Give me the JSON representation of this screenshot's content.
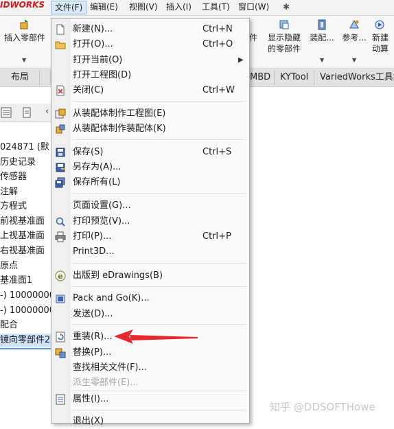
{
  "app": {
    "logo_text": "IDWORKS"
  },
  "menubar": {
    "items": [
      {
        "label": "文件(F)"
      },
      {
        "label": "编辑(E)"
      },
      {
        "label": "视图(V)"
      },
      {
        "label": "插入(I)"
      },
      {
        "label": "工具(T)"
      },
      {
        "label": "窗口(W)"
      }
    ]
  },
  "ribbon": {
    "insert_part": "插入零部件",
    "show_hidden_line1": "显示隐藏",
    "show_hidden_line2": "的零部件",
    "assembly": "装配...",
    "reference": "参考...",
    "new_motion_line1": "新建",
    "new_motion_line2": "动算",
    "cut_char": "件"
  },
  "tabs": {
    "layout": "布局",
    "mbd": "MBD",
    "kytool": "KYTool",
    "variedworks": "VariedWorks工具集"
  },
  "tree": {
    "items": [
      {
        "label": "024871 (默"
      },
      {
        "label": "历史记录"
      },
      {
        "label": "传感器"
      },
      {
        "label": "注解"
      },
      {
        "label": "方程式"
      },
      {
        "label": "前视基准面"
      },
      {
        "label": "上视基准面"
      },
      {
        "label": "右视基准面"
      },
      {
        "label": "原点"
      },
      {
        "label": "基准面1"
      },
      {
        "label": "-) 10000000"
      },
      {
        "label": "-) 10000000"
      },
      {
        "label": "配合"
      },
      {
        "label": "镜向零部件2"
      }
    ]
  },
  "file_menu": {
    "new": {
      "label": "新建(N)...",
      "shortcut": "Ctrl+N"
    },
    "open": {
      "label": "打开(O)...",
      "shortcut": "Ctrl+O"
    },
    "open_current": {
      "label": "打开当前(O)"
    },
    "open_drawing": {
      "label": "打开工程图(D)"
    },
    "close": {
      "label": "关闭(C)",
      "shortcut": "Ctrl+W"
    },
    "make_drawing": {
      "label": "从装配体制作工程图(E)"
    },
    "make_assembly": {
      "label": "从装配体制作装配体(K)"
    },
    "save": {
      "label": "保存(S)",
      "shortcut": "Ctrl+S"
    },
    "save_as": {
      "label": "另存为(A)..."
    },
    "save_all": {
      "label": "保存所有(L)"
    },
    "page_setup": {
      "label": "页面设置(G)..."
    },
    "print_preview": {
      "label": "打印预览(V)..."
    },
    "print": {
      "label": "打印(P)...",
      "shortcut": "Ctrl+P"
    },
    "print3d": {
      "label": "Print3D..."
    },
    "publish_edrawings": {
      "label": "出版到 eDrawings(B)"
    },
    "pack_and_go": {
      "label": "Pack and Go(K)..."
    },
    "send": {
      "label": "发送(D)..."
    },
    "reload": {
      "label": "重装(R)..."
    },
    "replace": {
      "label": "替换(P)..."
    },
    "find_references": {
      "label": "查找相关文件(F)..."
    },
    "derived_part": {
      "label": "派生零部件(E)..."
    },
    "properties": {
      "label": "属性(I)..."
    },
    "exit": {
      "label": "退出(X)"
    }
  },
  "watermark": {
    "text": "知乎 @DDSOFTHowe"
  },
  "colors": {
    "logo_red": "#d7191b",
    "arrow_red": "#e5282b",
    "menu_bg": "#fafafa",
    "selection_blue": "#d0e4f8"
  }
}
